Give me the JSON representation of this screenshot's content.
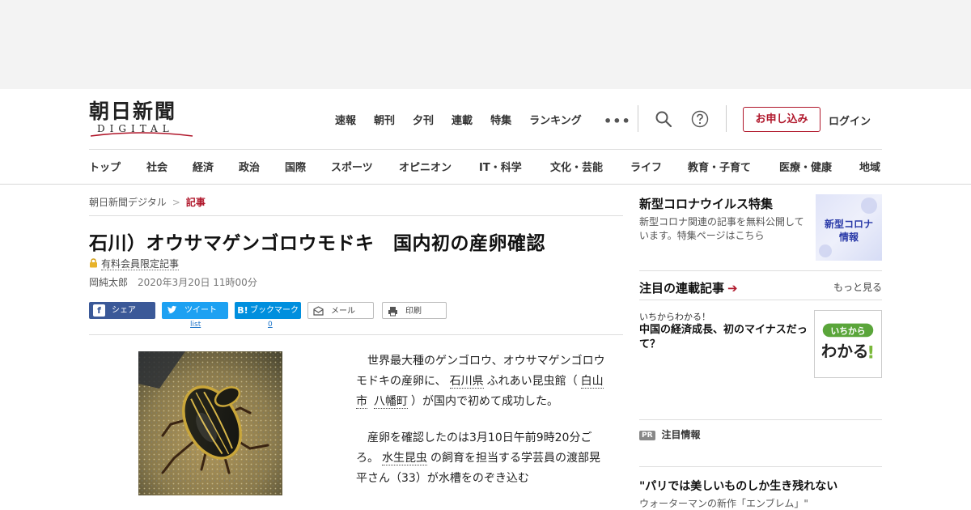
{
  "logo": {
    "main": "朝日新聞",
    "sub": "DIGITAL"
  },
  "topnav": [
    "速報",
    "朝刊",
    "夕刊",
    "連載",
    "特集",
    "ランキング"
  ],
  "header_actions": {
    "more": "•••",
    "signup": "お申し込み",
    "login": "ログイン"
  },
  "catnav": [
    "トップ",
    "社会",
    "経済",
    "政治",
    "国際",
    "スポーツ",
    "オピニオン",
    "IT・科学",
    "文化・芸能",
    "ライフ",
    "教育・子育て",
    "医療・健康",
    "地域"
  ],
  "breadcrumb": {
    "home": "朝日新聞デジタル",
    "separator": ">",
    "current": "記事"
  },
  "article": {
    "headline": "石川）オウサマゲンゴロウモドキ　国内初の産卵確認",
    "paid_label": "有料会員限定記事",
    "author": "岡純太郎",
    "date": "2020年3月20日 11時00分",
    "share": {
      "facebook": "シェア",
      "twitter": "ツイート",
      "hatena": "ブックマーク",
      "mail": "メール",
      "print": "印刷",
      "twitter_count": "list",
      "hatena_count": "0"
    },
    "p1_a": "世界最大種のゲンゴロウ、オウサマゲンゴロウモドキの産卵に、",
    "p1_link1": "石川県",
    "p1_b": "ふれあい昆虫館（",
    "p1_link2": "白山市",
    "p1_link3": "八幡町",
    "p1_c": "）が国内で初めて成功した。",
    "p2_a": "産卵を確認したのは3月10日午前9時20分ごろ。",
    "p2_link": "水生昆虫",
    "p2_b": "の飼育を担当する学芸員の渡部晃平さん（33）が水槽をのぞき込む"
  },
  "sidebar": {
    "corona_title": "新型コロナウイルス特集",
    "corona_text": "新型コロナ関連の記事を無料公開しています。特集ページはこちら",
    "corona_img_text": [
      "新型コロナ",
      "情報"
    ],
    "series_title": "注目の連載記事",
    "series_arrow": "➔",
    "more": "もっと見る",
    "series_kicker": "いちからわかる！",
    "series_headline": "中国の経済成長、初のマイナスだって？",
    "wakaru_img_text": [
      "いちから",
      "わかる",
      "!"
    ],
    "pr_badge": "PR",
    "pr_label": "注目情報",
    "promo_title": "\"パリでは美しいものしか生き残れない",
    "promo_sub": "ウォーターマンの新作「エンブレム」\""
  },
  "colors": {
    "accent": "#b0172b",
    "facebook": "#3b5998",
    "twitter": "#1da1f2",
    "hatena": "#008fde"
  },
  "icons": [
    "search-icon",
    "help-icon",
    "lock-icon",
    "facebook-icon",
    "twitter-icon",
    "hatena-icon",
    "mail-icon",
    "print-icon"
  ]
}
